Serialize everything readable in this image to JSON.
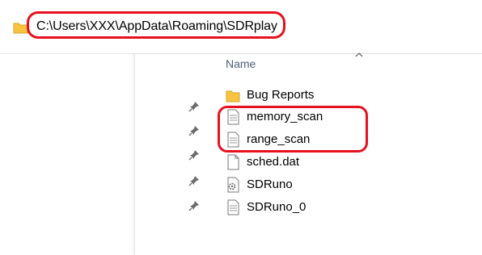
{
  "address_bar": {
    "path": "C:\\Users\\XXX\\AppData\\Roaming\\SDRplay"
  },
  "file_list": {
    "column_header": "Name",
    "items": [
      {
        "name": "Bug Reports",
        "icon": "folder-icon"
      },
      {
        "name": "memory_scan",
        "icon": "text-file-icon"
      },
      {
        "name": "range_scan",
        "icon": "text-file-icon"
      },
      {
        "name": "sched.dat",
        "icon": "blank-file-icon"
      },
      {
        "name": "SDRuno",
        "icon": "settings-file-icon"
      },
      {
        "name": "SDRuno_0",
        "icon": "text-file-icon"
      }
    ]
  },
  "colors": {
    "highlight": "#e8101e",
    "folder": "#f5c542",
    "header_text": "#4c607a"
  }
}
